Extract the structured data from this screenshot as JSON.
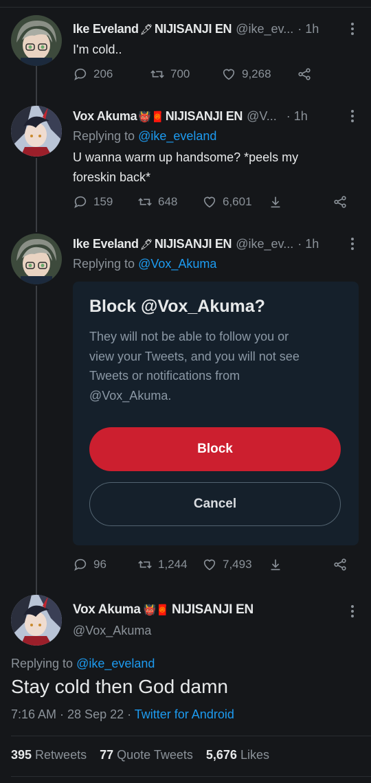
{
  "tweet1": {
    "name": "Ike Eveland",
    "name_emoji": "🖋",
    "affiliation": "NIJISANJI EN",
    "handle": "@ike_ev...",
    "time": "· 1h",
    "text": "I'm cold..",
    "replies": "206",
    "retweets": "700",
    "likes": "9,268"
  },
  "tweet2": {
    "name": "Vox Akuma",
    "name_emoji": "👹🧧",
    "affiliation": "NIJISANJI EN",
    "handle": "@V...",
    "time": "· 1h",
    "replying_prefix": "Replying to ",
    "replying_handle": "@ike_eveland",
    "text_line1": "U wanna warm up handsome? *peels my",
    "text_line2": "foreskin back*",
    "replies": "159",
    "retweets": "648",
    "likes": "6,601"
  },
  "tweet3": {
    "name": "Ike Eveland",
    "name_emoji": "🖋",
    "affiliation": "NIJISANJI EN",
    "handle": "@ike_ev...",
    "time": "· 1h",
    "replying_prefix": "Replying to ",
    "replying_handle": "@Vox_Akuma",
    "replies": "96",
    "retweets": "1,244",
    "likes": "7,493"
  },
  "block_dialog": {
    "title": "Block @Vox_Akuma?",
    "desc_line1": "They will not be able to follow you or",
    "desc_line2": "view your Tweets, and you will not see",
    "desc_line3": "Tweets or notifications from",
    "desc_line4": "@Vox_Akuma.",
    "block_label": "Block",
    "cancel_label": "Cancel"
  },
  "main_tweet": {
    "name": "Vox Akuma",
    "name_emoji": "👹🧧",
    "affiliation": "NIJISANJI EN",
    "handle": "@Vox_Akuma",
    "replying_prefix": "Replying to ",
    "replying_handle": "@ike_eveland",
    "text": "Stay cold then God damn",
    "timestamp": "7:16 AM · 28 Sep 22 · ",
    "source": "Twitter for Android",
    "retweets_count": "395",
    "retweets_label": " Retweets",
    "quotes_count": "77",
    "quotes_label": " Quote Tweets",
    "likes_count": "5,676",
    "likes_label": " Likes"
  },
  "colors": {
    "background": "#15171a",
    "link": "#1d9bf0",
    "block_button": "#cc1f2f",
    "dialog": "#15202b"
  }
}
